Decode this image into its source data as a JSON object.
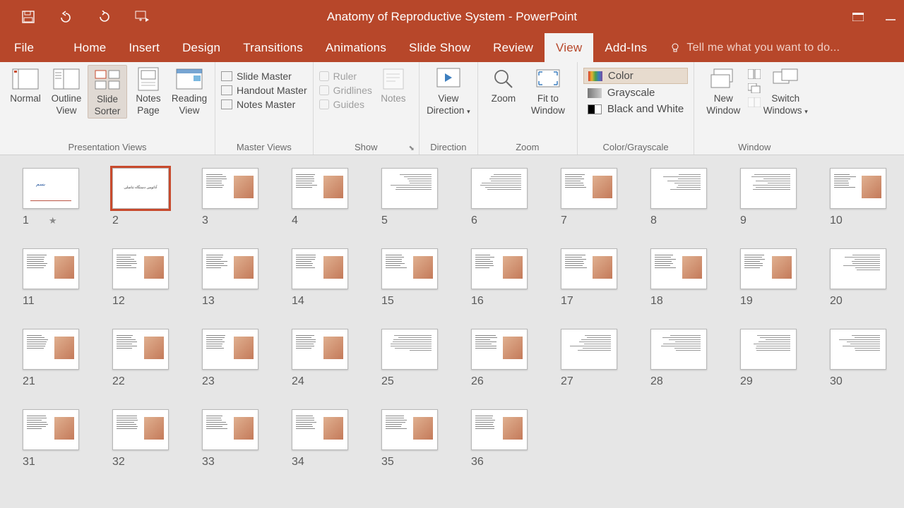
{
  "titlebar": {
    "title": "Anatomy of Reproductive System - PowerPoint"
  },
  "tabs": {
    "file": "File",
    "home": "Home",
    "insert": "Insert",
    "design": "Design",
    "transitions": "Transitions",
    "animations": "Animations",
    "slideshow": "Slide Show",
    "review": "Review",
    "view": "View",
    "addins": "Add-Ins",
    "tellme": "Tell me what you want to do..."
  },
  "ribbon": {
    "presentation_views": {
      "label": "Presentation Views",
      "normal": "Normal",
      "outline": "Outline\nView",
      "sorter": "Slide\nSorter",
      "notes": "Notes\nPage",
      "reading": "Reading\nView"
    },
    "master_views": {
      "label": "Master Views",
      "slide_master": "Slide Master",
      "handout_master": "Handout Master",
      "notes_master": "Notes Master"
    },
    "show": {
      "label": "Show",
      "ruler": "Ruler",
      "gridlines": "Gridlines",
      "guides": "Guides",
      "notes": "Notes"
    },
    "direction": {
      "label": "Direction",
      "btn": "View\nDirection"
    },
    "zoom": {
      "label": "Zoom",
      "zoom": "Zoom",
      "fit": "Fit to\nWindow"
    },
    "color_grayscale": {
      "label": "Color/Grayscale",
      "color": "Color",
      "grayscale": "Grayscale",
      "bw": "Black and White"
    },
    "window": {
      "label": "Window",
      "new_window": "New\nWindow",
      "switch": "Switch\nWindows"
    }
  },
  "slides": [
    {
      "n": "1",
      "star": true
    },
    {
      "n": "2",
      "sel": true
    },
    {
      "n": "3"
    },
    {
      "n": "4"
    },
    {
      "n": "5"
    },
    {
      "n": "6"
    },
    {
      "n": "7"
    },
    {
      "n": "8"
    },
    {
      "n": "9"
    },
    {
      "n": "10"
    },
    {
      "n": "11"
    },
    {
      "n": "12"
    },
    {
      "n": "13"
    },
    {
      "n": "14"
    },
    {
      "n": "15"
    },
    {
      "n": "16"
    },
    {
      "n": "17"
    },
    {
      "n": "18"
    },
    {
      "n": "19"
    },
    {
      "n": "20"
    },
    {
      "n": "21"
    },
    {
      "n": "22"
    },
    {
      "n": "23"
    },
    {
      "n": "24"
    },
    {
      "n": "25"
    },
    {
      "n": "26"
    },
    {
      "n": "27"
    },
    {
      "n": "28"
    },
    {
      "n": "29"
    },
    {
      "n": "30"
    },
    {
      "n": "31"
    },
    {
      "n": "32"
    },
    {
      "n": "33"
    },
    {
      "n": "34"
    },
    {
      "n": "35"
    },
    {
      "n": "36"
    }
  ]
}
